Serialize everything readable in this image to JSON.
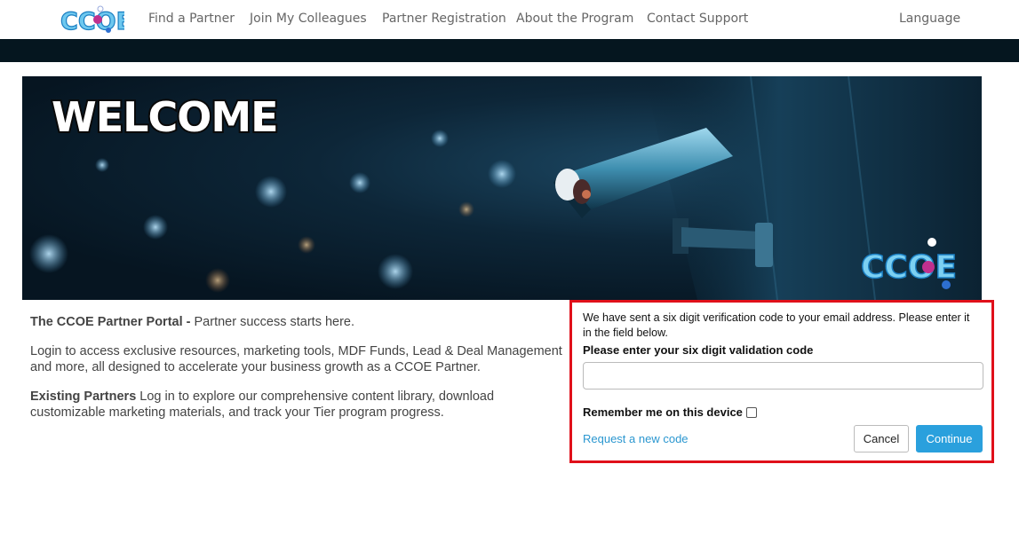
{
  "header": {
    "logo_text": "CCOE",
    "nav": [
      {
        "label": "Find a Partner"
      },
      {
        "label": "Join My Colleagues"
      },
      {
        "label": "Partner Registration"
      },
      {
        "label": "About the Program"
      },
      {
        "label": "Contact Support"
      }
    ],
    "language_label": "Language"
  },
  "banner": {
    "headline": "WELCOME",
    "logo_text": "CCOE"
  },
  "intro": {
    "portal_title": "The CCOE Partner Portal -",
    "portal_tagline": " Partner success starts here.",
    "login_text": "Login to access exclusive resources, marketing tools, MDF Funds, Lead & Deal Management and more, all designed to accelerate your business growth as a CCOE Partner.",
    "existing_title": "Existing Partners",
    "existing_text": " Log in to explore our comprehensive content library, download customizable marketing materials, and track your Tier program progress."
  },
  "verify": {
    "message": "We have sent a six digit verification code to your email address. Please enter it in the field below.",
    "code_label": "Please enter your six digit validation code",
    "code_value": "",
    "remember_label": "Remember me on this device",
    "remember_checked": false,
    "request_link": "Request a new code",
    "cancel_label": "Cancel",
    "continue_label": "Continue"
  },
  "colors": {
    "accent": "#2aa0dd",
    "highlight_border": "#e0101a",
    "dark_bar": "#05161f"
  }
}
